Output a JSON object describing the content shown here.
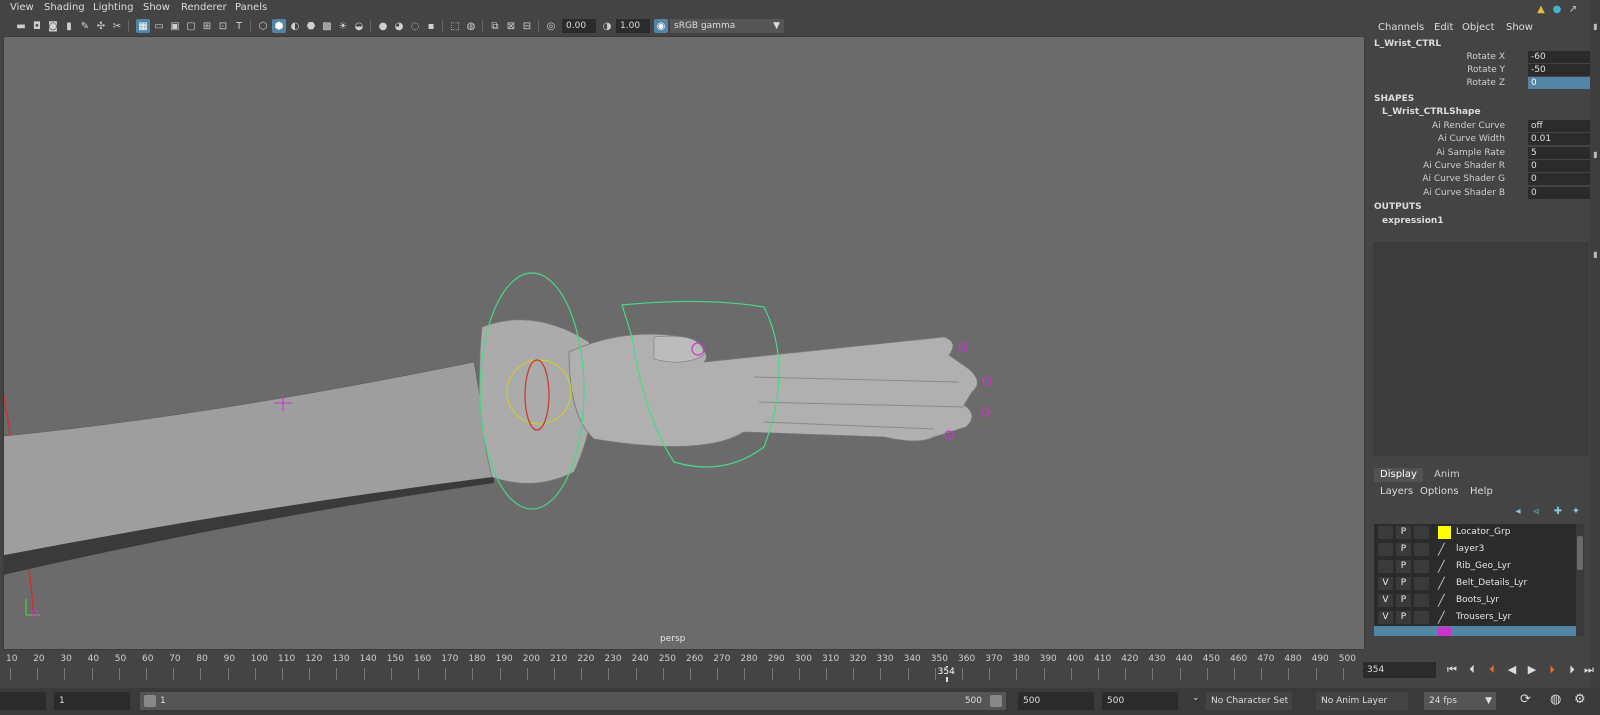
{
  "menubar": {
    "items": [
      "View",
      "Shading",
      "Lighting",
      "Show",
      "Renderer",
      "Panels"
    ]
  },
  "toolbar": {
    "exposure_value": "0.00",
    "gamma_value": "1.00",
    "color_space": "sRGB gamma"
  },
  "viewport": {
    "camera_label": "persp"
  },
  "channel_box": {
    "menus": [
      "Channels",
      "Edit",
      "Object",
      "Show"
    ],
    "object_name": "L_Wrist_CTRL",
    "channels": [
      {
        "label": "Rotate X",
        "value": "-60"
      },
      {
        "label": "Rotate Y",
        "value": "-50"
      },
      {
        "label": "Rotate Z",
        "value": "0"
      }
    ],
    "shapes_heading": "SHAPES",
    "shape_name": "L_Wrist_CTRLShape",
    "shape_attrs": [
      {
        "label": "Ai Render Curve",
        "value": "off"
      },
      {
        "label": "Ai Curve Width",
        "value": "0.01"
      },
      {
        "label": "Ai Sample Rate",
        "value": "5"
      },
      {
        "label": "Ai Curve Shader R",
        "value": "0"
      },
      {
        "label": "Ai Curve Shader G",
        "value": "0"
      },
      {
        "label": "Ai Curve Shader B",
        "value": "0"
      }
    ],
    "outputs_heading": "OUTPUTS",
    "output_name": "expression1"
  },
  "layer_editor": {
    "tabs": [
      "Display",
      "Anim"
    ],
    "menus": [
      "Layers",
      "Options",
      "Help"
    ],
    "layers": [
      {
        "v": "",
        "p": "P",
        "name": "Locator_Grp",
        "color": "#ffff00"
      },
      {
        "v": "",
        "p": "P",
        "name": "layer3",
        "color": ""
      },
      {
        "v": "",
        "p": "P",
        "name": "Rib_Geo_Lyr",
        "color": ""
      },
      {
        "v": "V",
        "p": "P",
        "name": "Belt_Details_Lyr",
        "color": ""
      },
      {
        "v": "V",
        "p": "P",
        "name": "Boots_Lyr",
        "color": ""
      },
      {
        "v": "V",
        "p": "P",
        "name": "Trousers_Lyr",
        "color": ""
      }
    ]
  },
  "timeline": {
    "ticks": [
      "10",
      "20",
      "30",
      "40",
      "50",
      "60",
      "70",
      "80",
      "90",
      "100",
      "110",
      "120",
      "130",
      "140",
      "150",
      "160",
      "170",
      "180",
      "190",
      "200",
      "210",
      "220",
      "230",
      "240",
      "250",
      "260",
      "270",
      "280",
      "290",
      "300",
      "310",
      "320",
      "330",
      "340",
      "350",
      "360",
      "370",
      "380",
      "390",
      "400",
      "410",
      "420",
      "430",
      "440",
      "450",
      "460",
      "470",
      "480",
      "490",
      "500"
    ],
    "playhead_label": "354",
    "current_frame": "354"
  },
  "range_bar": {
    "start_field": "1",
    "slider_start": "1",
    "slider_end": "500",
    "end_field": "500",
    "anim_end": "500",
    "character_set": "No Character Set",
    "anim_layer": "No Anim Layer",
    "fps": "24 fps"
  }
}
